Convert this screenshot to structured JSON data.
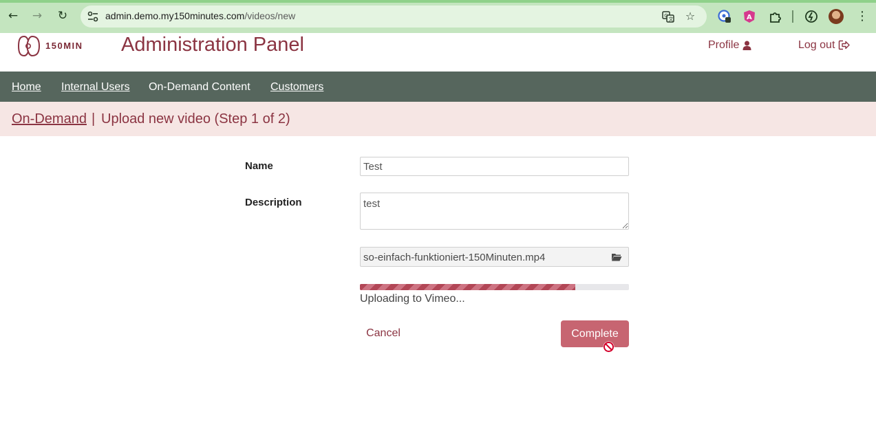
{
  "browser": {
    "url_host": "admin.demo.my150minutes.com",
    "url_path": "/videos/new",
    "icons": [
      "back-arrow-icon",
      "forward-arrow-icon",
      "reload-icon",
      "site-settings-icon",
      "translate-icon",
      "bookmark-star-icon",
      "extension-icon",
      "puzzle-extensions-icon",
      "sync-icon",
      "profile-avatar",
      "more-menu-icon"
    ]
  },
  "header": {
    "logo_text": "150MIN",
    "title": "Administration Panel",
    "profile_label": "Profile",
    "logout_label": "Log out"
  },
  "nav": {
    "items": [
      {
        "label": "Home"
      },
      {
        "label": "Internal Users"
      },
      {
        "label": "On-Demand Content"
      },
      {
        "label": "Customers"
      }
    ]
  },
  "breadcrumb": {
    "link": "On-Demand",
    "separator": "|",
    "current": "Upload new video (Step 1 of 2)"
  },
  "form": {
    "name_label": "Name",
    "name_value": "Test",
    "description_label": "Description",
    "description_value": "test",
    "file_name": "so-einfach-funktioniert-150Minuten.mp4",
    "upload_progress": 0.8,
    "upload_status": "Uploading to Vimeo...",
    "cancel_label": "Cancel",
    "complete_label": "Complete"
  },
  "colors": {
    "brand": "#8b3442",
    "nav_bg": "#56665d",
    "breadcrumb_bg": "#f6e6e4",
    "complete_button_bg": "#c76571",
    "chrome_bg": "#c4e5bf"
  }
}
